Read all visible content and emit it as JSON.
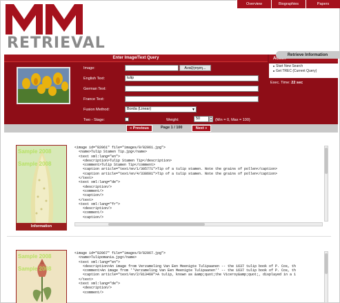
{
  "nav": {
    "items": [
      {
        "label": "Overview"
      },
      {
        "label": "Biographies"
      },
      {
        "label": "Papers"
      }
    ]
  },
  "logo": {
    "text": "RETRIEVAL",
    "brand_color": "#a5111d"
  },
  "query_panel": {
    "title": "Enter Image/Text Query",
    "image_label": "Image:",
    "browse_label": "Αναζήτηση...",
    "english_label": "English Text:",
    "english_value": "tulip",
    "german_label": "German Text:",
    "german_value": "",
    "france_label": "France Text:",
    "france_value": "",
    "fusion_label": "Fusion Method:",
    "fusion_value": "Borda (Linear)",
    "twostage_label": "Two - Stage:",
    "twostage_checked": false,
    "weight_label": "Weight:",
    "weight_value": "50",
    "weight_hint": "(Min = 0, Max = 100)"
  },
  "action": {
    "title": "Action",
    "items": [
      {
        "label": "Start New Search"
      },
      {
        "label": "Get TREC (Current Query)"
      }
    ],
    "exec_label": "Exec. Time:",
    "exec_value": "22 sec",
    "retrieve_label": "Retrieve Information"
  },
  "pager": {
    "prev_label": "« Previous",
    "page_text": "Page 1 / 100",
    "next_label": "Next »"
  },
  "results": [
    {
      "caption": "Information",
      "watermark": "Sample 2008",
      "xml": "<image id=\"82061\" file=\"images/9/82061.jpg\">\n  <name>Tulip Stamen Tip.jpg</name>\n  <text xml:lang=\"en\">\n    <description>Tulip Stamen Tip</description>\n    <comment>Tulip Stamen Tip</comment>\n    <caption article=\"text/en/1/305771\">Tip of a tulip stamen. Note the grains of pollen</caption>\n    <caption article=\"text/en/4/338601\">Tip of a tulip stamen. Note the grains of pollen</caption>\n  </text>\n  <text xml:lang=\"de\">\n    <description/>\n    <comment/>\n    <caption/>\n  </text>\n  <text xml:lang=\"fr\">\n    <description/>\n    <comment/>\n    <caption/>\n  </text>\n  <comment/>\n  <license>GFDL</license>\n</image>"
    },
    {
      "caption": "",
      "watermark": "Sample 2008",
      "xml": "<image id=\"82067\" file=\"images/9/82067.jpg\">\n  <name>Tulipomania.jpg</name>\n  <text xml:lang=\"en\">\n    <description>An image from Verzameling Van Een Meenigte Tulipaanen -- the 1637 tulip book of P. Cos, th\n    <comment>An image from ''Verzameling Van Een Meenigte Tulipaanen'' -- the 1637 tulip book of P. Cos, th\n    <caption article=\"text/en/2/813460\">A tulip, known as &amp;quot;the Viceroy&amp;quot;, displayed in a 1\n  </text>\n  <text xml:lang=\"de\">\n    <description/>\n    <comment/>"
    }
  ]
}
